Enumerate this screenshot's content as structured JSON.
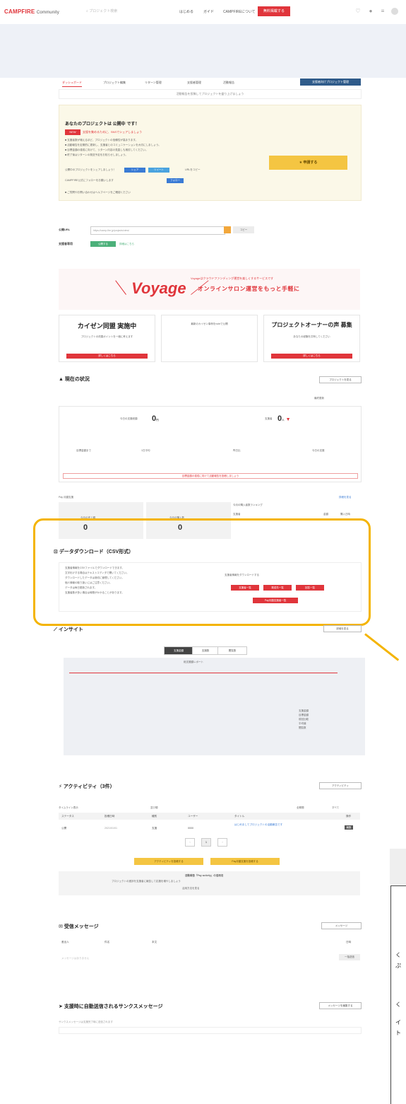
{
  "nav": {
    "logo": "CAMPFIRE",
    "logo_sub": "Community",
    "search_placeholder": "プロジェクト検索",
    "links": [
      "はじめる",
      "ガイド",
      "CAMPFIREについて"
    ],
    "cta": "無料掲載する"
  },
  "tabs": [
    "ダッシュボード",
    "プロジェクト編集",
    "リターン管理",
    "支援者管理",
    "活動報告"
  ],
  "tab_action": "支援者向けプロジェクト管理",
  "notice": "活動報告を投稿してプロジェクトを盛り上げましょう",
  "promo": {
    "title": "あなたのプロジェクトは 公開中 です！",
    "badge": "NEW",
    "badge_text": "支援を集めるために、SNSでシェアしましょう",
    "lines": [
      "■ 支援者数が増えるほど、プロジェクトの信頼性が高まります。",
      "■ 活動報告を定期的に更新し、支援者とのコミュニケーションを大切にしましょう。",
      "■ 目標金額の達成に向けて、リターン内容の見直しも検討してください。",
      "■ 終了後はリターンの発送予定をお知らせしましょう。"
    ],
    "share_label": "公開中のプロジェクトをシェアしましょう！",
    "share_buttons": [
      "シェア",
      "ツイート"
    ],
    "share_note": "URLをコピー",
    "sub_line": "CAMPFIRE公式にフォローをお願いします",
    "sub_button": "フォロー",
    "footnote": "■ ご質問やお問い合わせはヘルプページをご確認ください",
    "apply_button": "★ 申請する"
  },
  "url_row": {
    "label": "公開URL",
    "value": "https://camp-fire.jp/projects/view/",
    "copy_label": "コピー"
  },
  "support_row": {
    "label": "支援者専用",
    "button": "公開する",
    "link": "詳細はこちら"
  },
  "voyage": {
    "title": "Voyage",
    "sub": "Voyageはクラウドファンディング運営を楽しくするサービスです",
    "sub2": "オンラインサロン運営をもっと手軽に"
  },
  "cards": [
    {
      "title": "カイゼン同盟 実施中",
      "text": "プロジェクトの改善ポイントを一緒に考えます",
      "button": "詳しくはこちら"
    },
    {
      "title": "",
      "text": "最新のカイゼン事例をnoteで公開",
      "button": ""
    },
    {
      "title": "プロジェクトオーナーの声 募集",
      "text": "あなたの経験を共有してください",
      "button": "詳しくはこちら"
    }
  ],
  "status": {
    "title": "現在の状況",
    "button": "プロジェクトを見る",
    "updated": "最終更新",
    "amount_label": "今日の支援総額",
    "amount": "0",
    "amount_unit": "円",
    "count_label": "支援者",
    "count": "0",
    "count_unit": "人",
    "cols": [
      "目標金額まで",
      "1日平均",
      "昨日比",
      "今日の支援"
    ],
    "warning": "目標金額の達成に向けて活動報告を投稿しましょう",
    "sub_label": "Pay 月額支援",
    "link": "詳細を見る",
    "month_amount_label": "今月の売上額",
    "month_amount": "0",
    "month_count_label": "今月の購入数",
    "month_count": "0",
    "right_label": "今月の購入者数ランキング",
    "right_cols": [
      "支援者",
      "金額",
      "購入日時"
    ]
  },
  "download": {
    "title": "データダウンロード（CSV形式）",
    "bullets": [
      "支援者情報をCSVファイルでダウンロードできます。",
      "文字化けする場合はテキストエディタで開いてください。",
      "ダウンロードしたデータは適切に管理してください。",
      "個人情報の取り扱いにはご注意ください。",
      "データは毎日更新されます。",
      "支援者数が多い場合は時間がかかることがあります。"
    ],
    "right_text": "支援者情報をダウンロードする",
    "buttons": [
      "支援者一覧",
      "発送先一覧",
      "回答一覧",
      "Pay月額支援者一覧"
    ]
  },
  "insight": {
    "title": "インサイト",
    "button": "詳細を見る",
    "segments": [
      "支援金額",
      "支援数",
      "閲覧数"
    ],
    "chart_title": "総支援額レポート",
    "legend": [
      "支援金額",
      "目標金額",
      "前回比較",
      "平均値",
      "閲覧数"
    ]
  },
  "activity": {
    "title": "アクティビティ（3件）",
    "button": "アクティビティ",
    "filters": [
      "タイムライン表示",
      "並び順",
      "全期間",
      "すべて"
    ],
    "headers": [
      "ステータス",
      "投稿日時",
      "種別",
      "ユーザー",
      "タイトル",
      "操作"
    ],
    "row": [
      "公開",
      "2021/01/01",
      "支援",
      "0000",
      "はじめましてプロジェクトの活動報告です",
      "編集"
    ],
    "page": "1",
    "buttons": [
      "アクティビティを投稿する",
      "Pay月額支援を投稿する"
    ],
    "info_title": "活動報告「Pay activity」の活用法",
    "info_text": "プロジェクトの進捗を支援者に報告して応援を増やしましょう",
    "info_link": "活用方法を見る"
  },
  "messages": {
    "title": "受信メッセージ",
    "button": "メッセージ",
    "headers": [
      "差出人",
      "件名",
      "本文",
      "日時"
    ],
    "empty": "メッセージはありません",
    "action": "一括送信"
  },
  "thanks": {
    "title": "支援時に自動送信されるサンクスメッセージ",
    "button": "メッセージを編集する",
    "note": "サンクスメッセージは支援完了時に送信されます"
  },
  "side": {
    "chars": [
      "く",
      "ぷ",
      "く",
      "イ",
      "ト"
    ]
  }
}
